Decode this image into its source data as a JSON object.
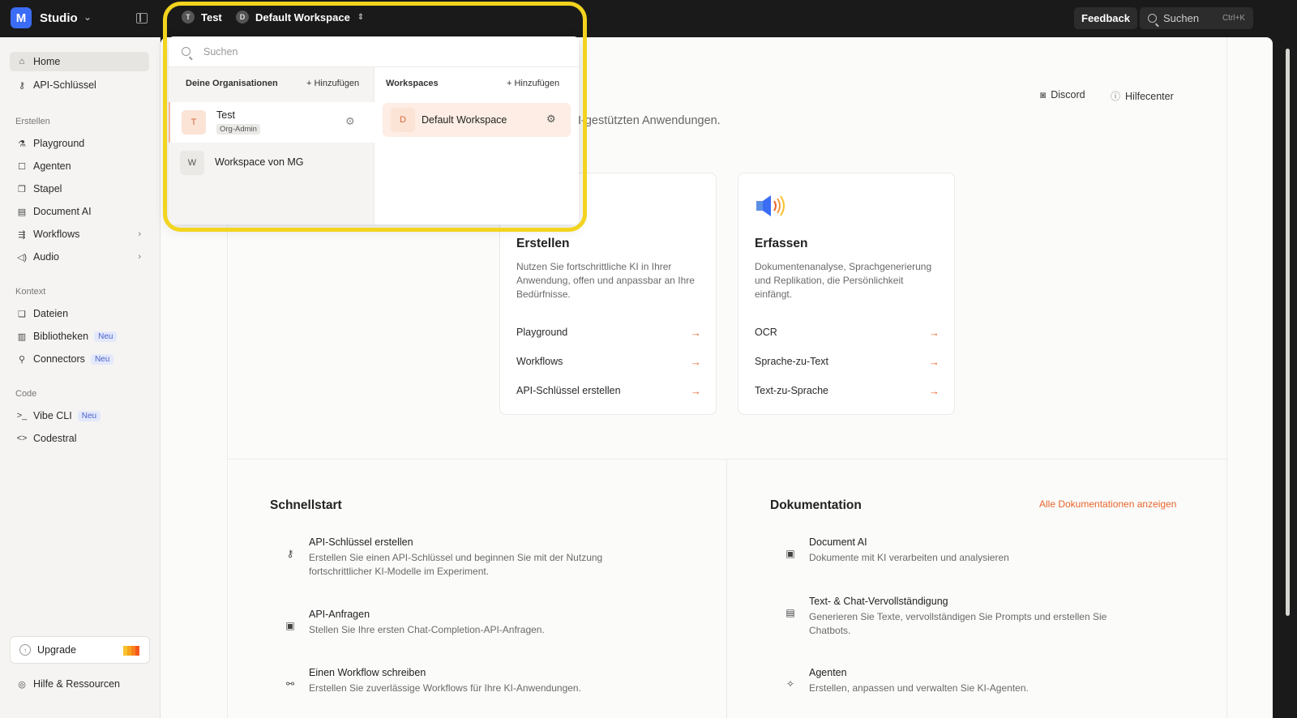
{
  "topbar": {
    "logo_glyph": "M",
    "app_name": "Studio",
    "org_crumb": {
      "initial": "T",
      "name": "Test"
    },
    "workspace_crumb": {
      "initial": "D",
      "name": "Default Workspace"
    },
    "feedback_label": "Feedback",
    "search_label": "Suchen",
    "search_shortcut": "Ctrl+K"
  },
  "sidebar": {
    "items_top": [
      {
        "label": "Home",
        "icon": "home-icon"
      },
      {
        "label": "API-Schlüssel",
        "icon": "key-icon"
      }
    ],
    "section_erstellen": "Erstellen",
    "items_erstellen": [
      {
        "label": "Playground",
        "icon": "flask-icon"
      },
      {
        "label": "Agenten",
        "icon": "robot-icon"
      },
      {
        "label": "Stapel",
        "icon": "stack-icon"
      },
      {
        "label": "Document AI",
        "icon": "document-icon"
      },
      {
        "label": "Workflows",
        "icon": "workflow-icon"
      },
      {
        "label": "Audio",
        "icon": "speaker-icon"
      }
    ],
    "section_kontext": "Kontext",
    "items_kontext": [
      {
        "label": "Dateien",
        "icon": "files-icon"
      },
      {
        "label": "Bibliotheken",
        "icon": "book-icon",
        "badge": "Neu"
      },
      {
        "label": "Connectors",
        "icon": "plug-icon",
        "badge": "Neu"
      }
    ],
    "section_code": "Code",
    "items_code": [
      {
        "label": "Vibe CLI",
        "icon": "terminal-icon",
        "badge": "Neu"
      },
      {
        "label": "Codestral",
        "icon": "code-icon"
      }
    ],
    "upgrade_label": "Upgrade",
    "help_label": "Hilfe & Ressourcen"
  },
  "main": {
    "discord_label": "Discord",
    "helpcenter_label": "Hilfecenter",
    "partial_intro": "I-gestützten Anwendungen.",
    "card_erstellen": {
      "title": "Erstellen",
      "desc": "Nutzen Sie fortschrittliche KI in Ihrer Anwendung, offen und anpassbar an Ihre Bedürfnisse.",
      "links": [
        "Playground",
        "Workflows",
        "API-Schlüssel erstellen"
      ]
    },
    "card_erfassen": {
      "title": "Erfassen",
      "desc": "Dokumentenanalyse, Sprachgenerierung und Replikation, die Persönlichkeit einfängt.",
      "links": [
        "OCR",
        "Sprache-zu-Text",
        "Text-zu-Sprache"
      ]
    },
    "schnellstart": {
      "title": "Schnellstart",
      "items": [
        {
          "title": "API-Schlüssel erstellen",
          "desc": "Erstellen Sie einen API-Schlüssel und beginnen Sie mit der Nutzung fortschrittlicher KI-Modelle im Experiment."
        },
        {
          "title": "API-Anfragen",
          "desc": "Stellen Sie Ihre ersten Chat-Completion-API-Anfragen."
        },
        {
          "title": "Einen Workflow schreiben",
          "desc": "Erstellen Sie zuverlässige Workflows für Ihre KI-Anwendungen."
        }
      ]
    },
    "dokumentation": {
      "title": "Dokumentation",
      "all_link": "Alle Dokumentationen anzeigen",
      "items": [
        {
          "title": "Document AI",
          "desc": "Dokumente mit KI verarbeiten und analysieren"
        },
        {
          "title": "Text- & Chat-Vervollständigung",
          "desc": "Generieren Sie Texte, vervollständigen Sie Prompts und erstellen Sie Chatbots."
        },
        {
          "title": "Agenten",
          "desc": "Erstellen, anpassen und verwalten Sie KI-Agenten."
        }
      ]
    }
  },
  "popover": {
    "search_placeholder": "Suchen",
    "orgs_header": "Deine Organisationen",
    "orgs_add": "+ Hinzufügen",
    "orgs": [
      {
        "initial": "T",
        "name": "Test",
        "role": "Org-Admin"
      },
      {
        "initial": "W",
        "name": "Workspace von MG"
      }
    ],
    "workspaces_header": "Workspaces",
    "workspaces_add": "+ Hinzufügen",
    "workspaces": [
      {
        "initial": "D",
        "name": "Default Workspace"
      }
    ]
  },
  "colors": {
    "accent": "#e8662b",
    "highlight": "#f2d41f",
    "brand": "#3b6cf6"
  }
}
